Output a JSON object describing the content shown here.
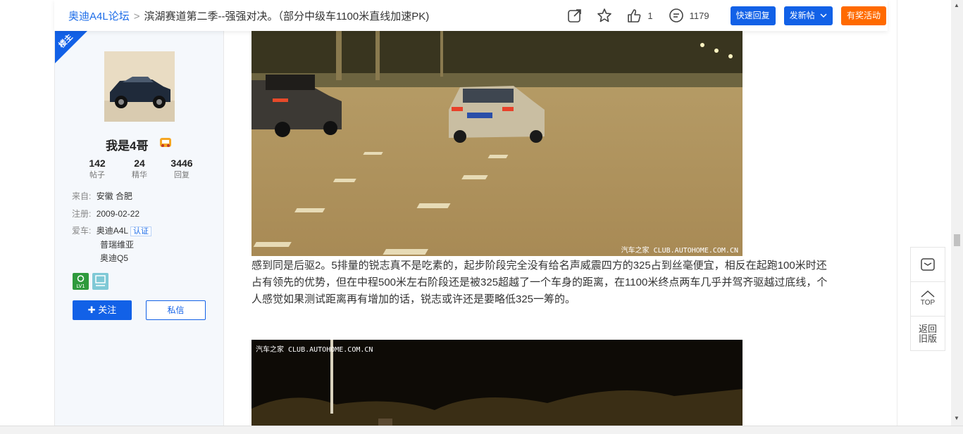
{
  "header": {
    "forum_link": "奥迪A4L论坛",
    "separator": ">",
    "thread_title": "滨湖赛道第二季--强强对决。（部分中级车1100米直线加速PK)",
    "like_count": "1",
    "reply_count": "1179",
    "quick_reply_label": "快速回复",
    "new_post_label": "发新帖",
    "reward_activity_label": "有奖活动"
  },
  "author": {
    "ribbon_label": "楼主",
    "username": "我是4哥",
    "stats": [
      {
        "value": "142",
        "label": "帖子"
      },
      {
        "value": "24",
        "label": "精华"
      },
      {
        "value": "3446",
        "label": "回复"
      }
    ],
    "location_key": "来自:",
    "location_value": "安徽 合肥",
    "registered_key": "注册:",
    "registered_value": "2009-02-22",
    "cars_key": "爱车:",
    "cars": [
      "奥迪A4L",
      "普瑞维亚",
      "奥迪Q5"
    ],
    "certified_label": "认证",
    "level_label": "LV1",
    "follow_label": "关注",
    "message_label": "私信"
  },
  "post": {
    "watermark": "汽车之家 CLUB.AUTOHOME.COM.CN",
    "paragraph": "感到同是后驱2。5排量的锐志真不是吃素的，起步阶段完全没有给名声威震四方的325占到丝毫便宜，相反在起跑100米时还占有领先的优势，但在中程500米左右阶段还是被325超越了一个车身的距离，在1100米终点两车几乎并驾齐驱越过底线，个人感觉如果测试距离再有增加的话，锐志或许还是要略低325一筹的。"
  },
  "side": {
    "top_label": "TOP",
    "back_old_line1": "返回",
    "back_old_line2": "旧版"
  },
  "colors": {
    "brand_blue": "#1261e7",
    "link_blue": "#1c6ce8",
    "orange": "#ff6a00"
  }
}
